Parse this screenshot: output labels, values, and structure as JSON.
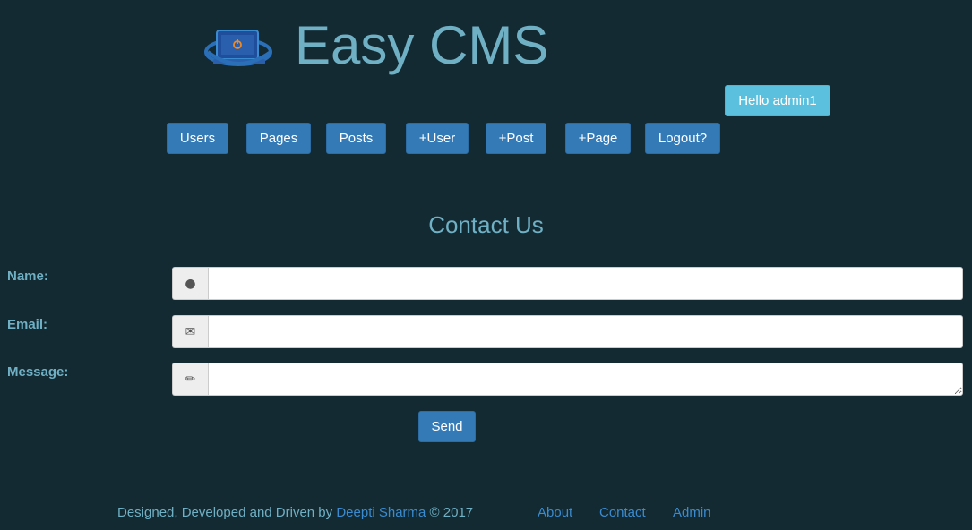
{
  "header": {
    "title": "Easy CMS",
    "greeting": "Hello admin1",
    "logo_icon": "laptop-power-icon"
  },
  "nav": {
    "items": [
      {
        "label": "Users"
      },
      {
        "label": "Pages"
      },
      {
        "label": "Posts"
      },
      {
        "label": "+User"
      },
      {
        "label": "+Post"
      },
      {
        "label": "+Page"
      },
      {
        "label": "Logout?"
      }
    ]
  },
  "contact": {
    "heading": "Contact Us",
    "name_label": "Name:",
    "email_label": "Email:",
    "message_label": "Message:",
    "name_value": "",
    "email_value": "",
    "message_value": "",
    "name_icon": "user-icon",
    "email_icon": "envelope-icon",
    "message_icon": "pencil-icon",
    "send_label": "Send"
  },
  "footer": {
    "credit_prefix": "Designed, Developed and Driven by ",
    "author": "Deepti Sharma",
    "credit_suffix": " © 2017",
    "links": [
      {
        "label": "About"
      },
      {
        "label": "Contact"
      },
      {
        "label": "Admin"
      }
    ]
  },
  "colors": {
    "background": "#132a33",
    "accent_text": "#6fb0c4",
    "primary_button": "#337ab7",
    "info_badge": "#5bc0de",
    "link": "#3a8bd0"
  }
}
